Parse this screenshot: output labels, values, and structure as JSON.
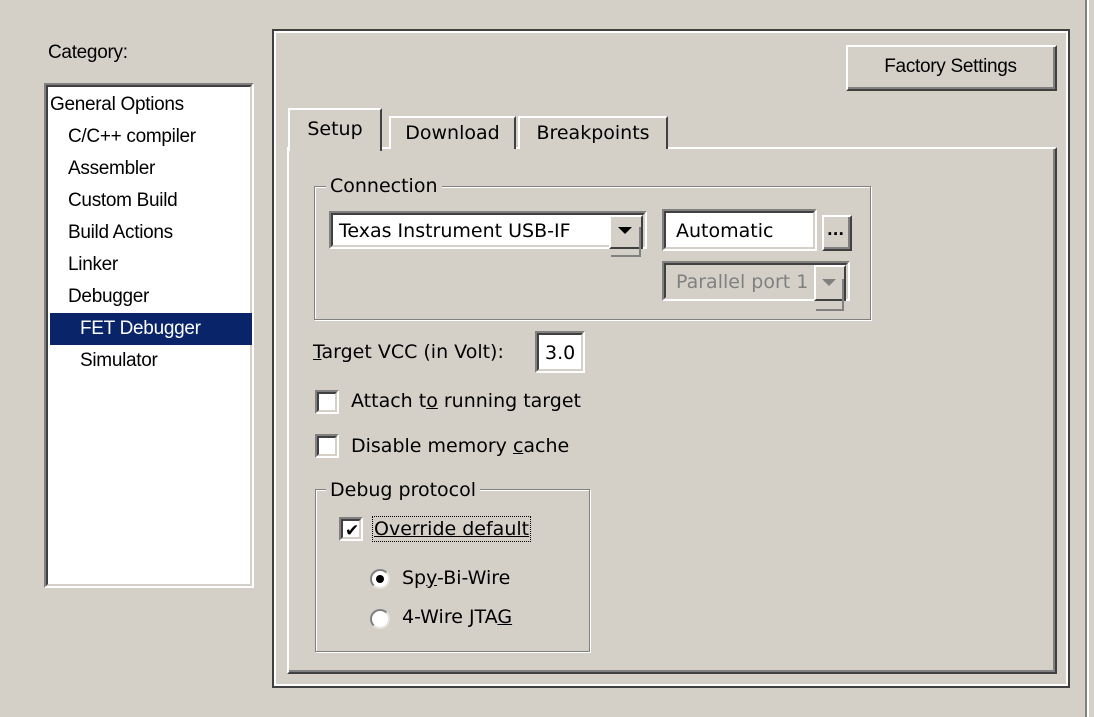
{
  "category": {
    "label": "Category:",
    "items": [
      {
        "label": "General Options"
      },
      {
        "label": "C/C++ compiler"
      },
      {
        "label": "Assembler"
      },
      {
        "label": "Custom Build"
      },
      {
        "label": "Build Actions"
      },
      {
        "label": "Linker"
      },
      {
        "label": "Debugger"
      },
      {
        "label": "FET Debugger"
      },
      {
        "label": "Simulator"
      }
    ],
    "selected": "FET Debugger"
  },
  "factory_settings_label": "Factory Settings",
  "tabs": [
    {
      "label": "Setup",
      "active": true
    },
    {
      "label": "Download",
      "active": false
    },
    {
      "label": "Breakpoints",
      "active": false
    }
  ],
  "connection": {
    "legend": "Connection",
    "driver_value": "Texas Instrument USB-IF",
    "port_value": "Automatic",
    "browse_label": "...",
    "parallel_value": "Parallel port 1"
  },
  "target_vcc": {
    "label_first": "T",
    "label_rest": "arget VCC (in Volt):",
    "value": "3.0"
  },
  "attach": {
    "pre": "Attach t",
    "accel": "o",
    "post": " running target",
    "checked": false
  },
  "disable_cache": {
    "pre": "Disable memory ",
    "accel": "c",
    "post": "ache",
    "checked": false
  },
  "debug_protocol": {
    "legend": "Debug protocol",
    "override_label": "Override default",
    "override_checked": true,
    "spy_pre": "Sp",
    "spy_accel": "y",
    "spy_post": "-Bi-Wire",
    "jtag_pre": "4-Wire JTA",
    "jtag_accel": "G",
    "selected": "Spy-Bi-Wire"
  },
  "colors": {
    "face": "#d4d0c8",
    "selection": "#0a246a",
    "shadow": "#808080",
    "dark_shadow": "#404040"
  }
}
